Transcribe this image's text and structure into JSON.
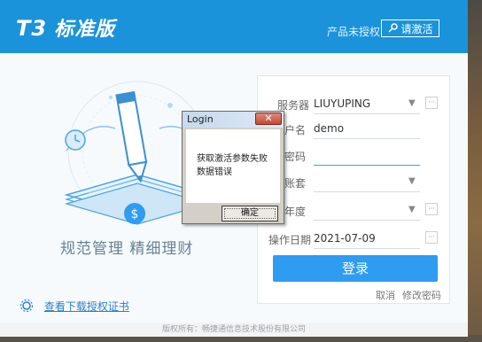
{
  "header": {
    "logo_mark": "T3",
    "logo_text": "标准版",
    "unauth_text": "产品未授权",
    "activate_label": "请激活"
  },
  "left": {
    "slogan": "规范管理  精细理财",
    "download_link": "查看下载授权证书"
  },
  "footer": {
    "copyright": "版权所有：畅捷通信息技术股份有限公司"
  },
  "login": {
    "server_label": "服务器",
    "server_value": "LIUYUPING",
    "user_label": "户名",
    "user_value": "demo",
    "password_label": "密码",
    "password_value": "",
    "account_label": "账套",
    "account_value": "",
    "year_label": "年度",
    "year_value": "",
    "date_label": "操作日期",
    "date_value": "2021-07-09",
    "login_button": "登录",
    "cancel_link": "取消",
    "change_password_link": "修改密码"
  },
  "dialog": {
    "title": "Login",
    "close": "✕",
    "message_line1": "获取激活参数失败",
    "message_line2": "数据错误",
    "ok_button": "确定"
  },
  "colors": {
    "brand_blue": "#1a93db",
    "button_blue": "#2e9cf0",
    "link_blue": "#2a7fc7"
  }
}
